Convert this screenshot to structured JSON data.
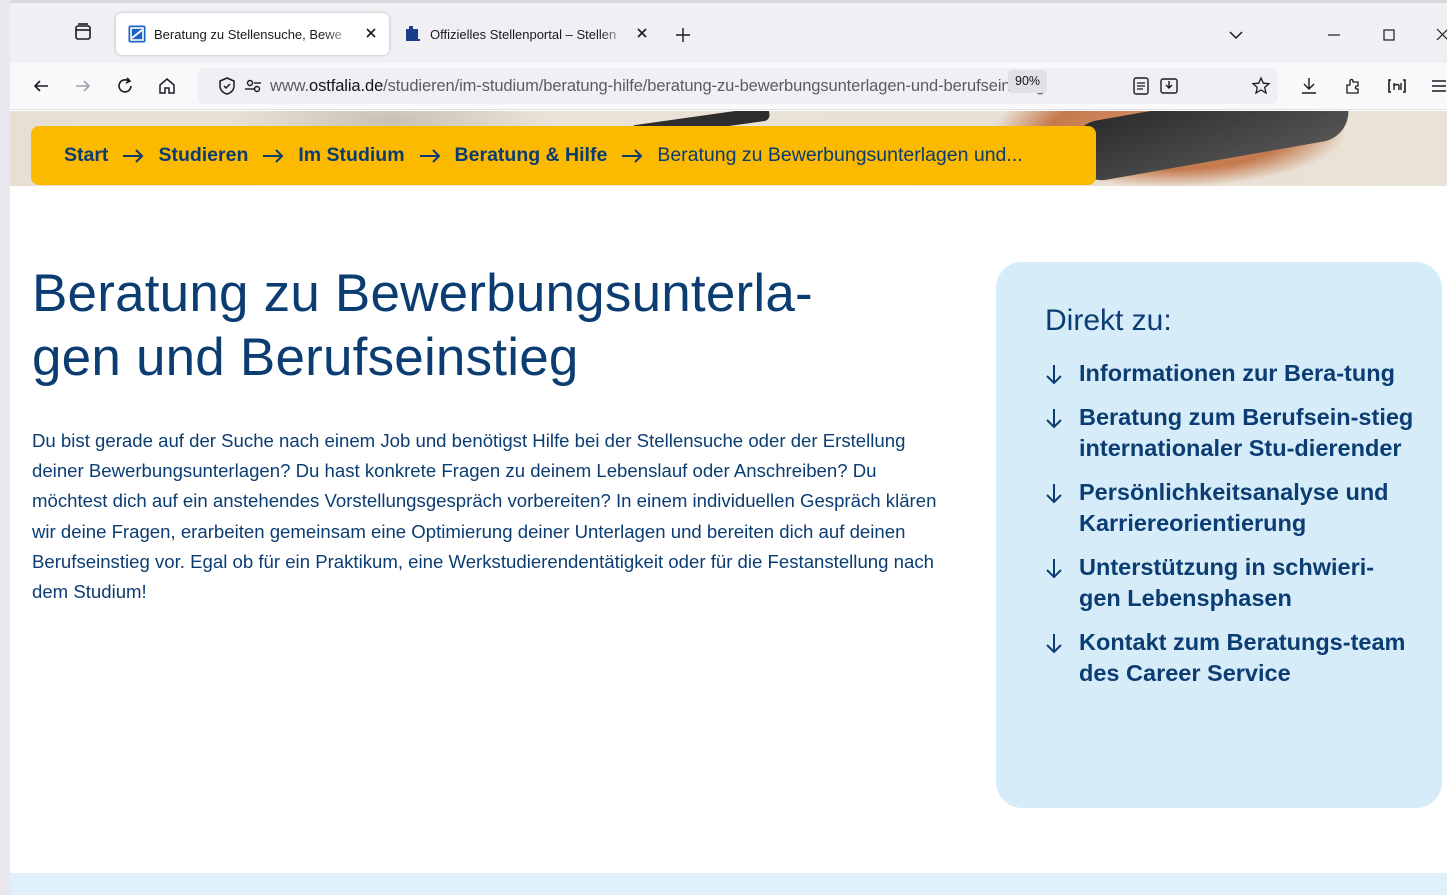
{
  "browser": {
    "tabs": [
      {
        "title": "Beratung zu Stellensuche, Bewe",
        "active": true,
        "favicon": "ostfalia-logo-icon"
      },
      {
        "title": "Offizielles Stellenportal – Stellen",
        "active": false,
        "favicon": "book-icon"
      }
    ],
    "url": {
      "prefix": "www.",
      "domain": "ostfalia.de",
      "path": "/studieren/im-studium/beratung-hilfe/beratung-zu-bewerbungsunterlagen-und-berufseinstieg"
    },
    "zoom": "90%",
    "accent": "#1b62c6"
  },
  "breadcrumb": {
    "items": [
      "Start",
      "Studieren",
      "Im Studium",
      "Beratung & Hilfe"
    ],
    "current": "Beratung zu Bewerbungsunterlagen und..."
  },
  "main": {
    "title_line1": "Beratung zu Bewerbungsunterla-",
    "title_line2": "gen und Berufseinstieg",
    "intro": "Du bist gerade auf der Suche nach einem Job und benötigst Hilfe bei der Stellensuche oder der Erstellung deiner Bewerbungsunterlagen? Du hast konkrete Fragen zu deinem Lebenslauf oder Anschreiben? Du möchtest dich auf ein anstehendes Vorstellungsgespräch vorbereiten? In einem individuellen Gespräch klären wir deine Fragen, erarbeiten gemeinsam eine Optimierung deiner Unterlagen und bereiten dich auf deinen Berufseinstieg vor. Egal ob für ein Praktikum, eine Werkstudierendentätigkeit oder für die Festanstellung nach dem Studium!"
  },
  "sidebar": {
    "heading": "Direkt zu:",
    "links": [
      "Informationen zur Bera-tung",
      "Beratung zum Berufsein-stieg internationaler Stu-dierender",
      "Persönlichkeitsanalyse und Karriereorientierung",
      "Unterstützung in schwieri-gen Lebensphasen",
      "Kontakt zum Beratungs-team des Career Service"
    ]
  },
  "colors": {
    "brand_blue": "#0b3d73",
    "breadcrumb_yellow": "#fbb900",
    "sidebar_bg": "#d6ecf9"
  }
}
